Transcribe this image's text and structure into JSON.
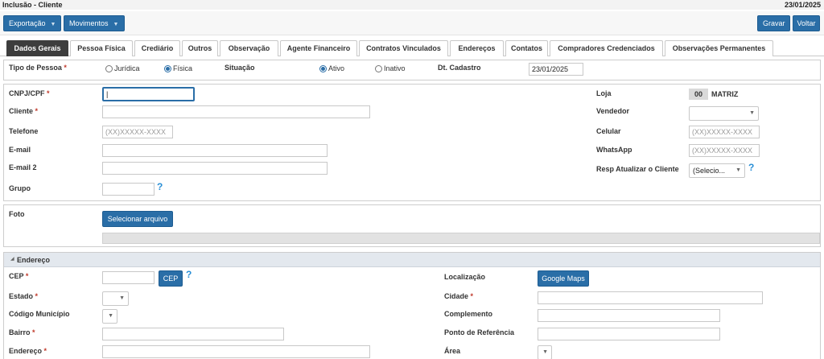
{
  "window": {
    "title": "Inclusão - Cliente",
    "date": "23/01/2025"
  },
  "toolbar": {
    "export_label": "Exportação",
    "movements_label": "Movimentos",
    "save_label": "Gravar",
    "back_label": "Voltar"
  },
  "tabs": [
    {
      "label": "Dados Gerais",
      "active": true
    },
    {
      "label": "Pessoa Física"
    },
    {
      "label": "Crediário"
    },
    {
      "label": "Outros"
    },
    {
      "label": "Observação"
    },
    {
      "label": "Agente Financeiro"
    },
    {
      "label": "Contratos Vinculados"
    },
    {
      "label": "Endereços"
    },
    {
      "label": "Contatos"
    },
    {
      "label": "Compradores Credenciados"
    },
    {
      "label": "Observações Permanentes"
    }
  ],
  "person_type": {
    "label": "Tipo de Pessoa",
    "required_mark": "*",
    "options": [
      "Jurídica",
      "Física"
    ],
    "selected": "Física",
    "situation_label": "Situação",
    "situation_options": [
      "Ativo",
      "Inativo"
    ],
    "situation_selected": "Ativo",
    "dt_cadastro_label": "Dt. Cadastro",
    "dt_cadastro_value": "23/01/2025"
  },
  "main_form": {
    "cnpj_label": "CNPJ/CPF",
    "cnpj_value": "|",
    "cliente_label": "Cliente",
    "telefone_label": "Telefone",
    "telefone_placeholder": "(XX)XXXXX-XXXX",
    "email_label": "E-mail",
    "email2_label": "E-mail 2",
    "grupo_label": "Grupo",
    "loja_label": "Loja",
    "loja_code": "00",
    "loja_name": "MATRIZ",
    "vendedor_label": "Vendedor",
    "celular_label": "Celular",
    "celular_placeholder": "(XX)XXXXX-XXXX",
    "whatsapp_label": "WhatsApp",
    "whatsapp_placeholder": "(XX)XXXXX-XXXX",
    "resp_label": "Resp Atualizar o Cliente",
    "resp_value": "(Selecio..."
  },
  "photo": {
    "label": "Foto",
    "select_button": "Selecionar arquivo"
  },
  "address": {
    "section_title": "Endereço",
    "cep_label": "CEP",
    "cep_button": "CEP",
    "estado_label": "Estado",
    "codigo_municipio_label": "Código Município",
    "bairro_label": "Bairro",
    "endereco_label": "Endereço",
    "localizacao_label": "Localização",
    "maps_button": "Google Maps",
    "cidade_label": "Cidade",
    "complemento_label": "Complemento",
    "ponto_referencia_label": "Ponto de Referência",
    "area_label": "Área"
  },
  "colors": {
    "accent": "#2a6ea7",
    "active_tab": "#3d3d3d",
    "required": "#c0392b",
    "help": "#2a8fd6"
  },
  "icons": {
    "dropdown": "chevron-down-icon",
    "help": "question-mark-icon",
    "section_toggle": "triangle-icon"
  }
}
